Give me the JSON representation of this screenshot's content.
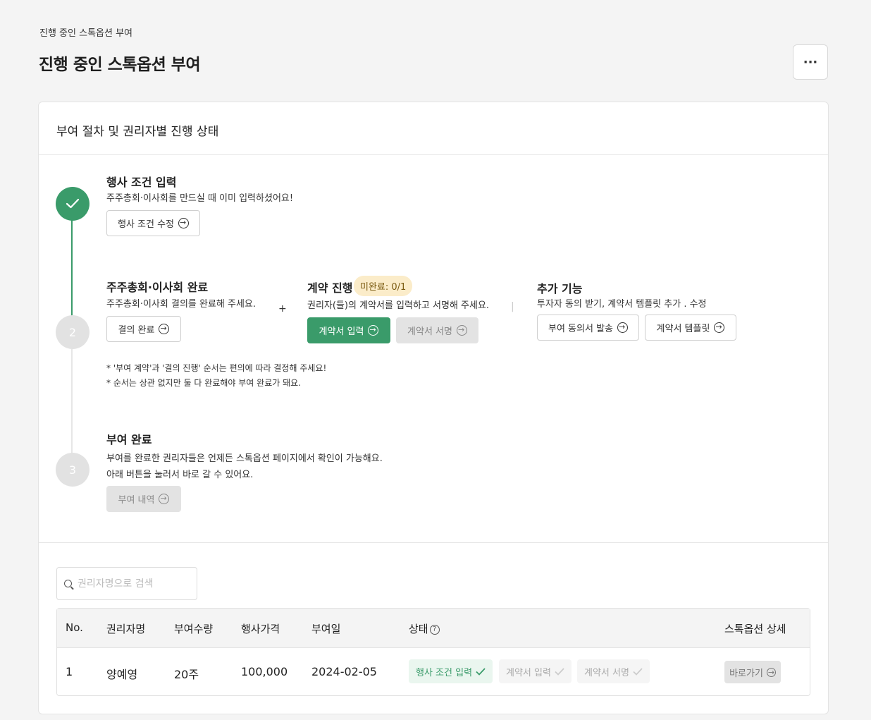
{
  "breadcrumb": "진행 중인 스톡옵션 부여",
  "page_title": "진행 중인 스톡옵션 부여",
  "more_label": "···",
  "card": {
    "title": "부여 절차 및 권리자별 진행 상태",
    "step1": {
      "title": "행사 조건 입력",
      "desc": "주주총회·이사회를 만드실 때 이미 입력하셨어요!",
      "button": "행사 조건 수정"
    },
    "step2": {
      "number": "2",
      "resolution_title": "주주총회·이사회 완료",
      "resolution_desc": "주주총회·이사회 결의를 완료해 주세요.",
      "resolution_button": "결의 완료",
      "plus": "+",
      "contract_title": "계약 진행",
      "contract_badge": "미완료: 0/1",
      "contract_desc": "권리자(들)의 계약서를 입력하고 서명해 주세요.",
      "contract_input_button": "계약서 입력",
      "contract_sign_button": "계약서 서명",
      "separator": "|",
      "extra_title": "추가 기능",
      "extra_desc": "투자자 동의 받기, 계약서 템플릿 추가 . 수정",
      "consent_button": "부여 동의서 발송",
      "template_button": "계약서 템플릿",
      "note1": "* '부여 계약'과 '결의 진행' 순서는 편의에 따라 결정해 주세요!",
      "note2": "* 순서는 상관 없지만 둘 다 완료해야 부여 완료가 돼요."
    },
    "step3": {
      "number": "3",
      "title": "부여 완료",
      "desc1": "부여를 완료한 권리자들은 언제든 스톡옵션 페이지에서 확인이 가능해요.",
      "desc2": "아래 버튼을 눌러서 바로 갈 수 있어요.",
      "button": "부여 내역"
    }
  },
  "search": {
    "placeholder": "권리자명으로 검색"
  },
  "table": {
    "headers": [
      "No.",
      "권리자명",
      "부여수량",
      "행사가격",
      "부여일",
      "상태",
      "스톡옵션 상세"
    ],
    "help_mark": "?",
    "rows": [
      {
        "no": "1",
        "name": "양예영",
        "quantity": "20주",
        "price": "100,000",
        "date": "2024-02-05",
        "status": [
          "행사 조건 입력",
          "계약서 입력",
          "계약서 서명"
        ],
        "action": "바로가기"
      }
    ]
  },
  "colors": {
    "accent": "#3a9b6a",
    "badge_bg": "#fbecc9",
    "disabled": "#e3e3e3"
  }
}
